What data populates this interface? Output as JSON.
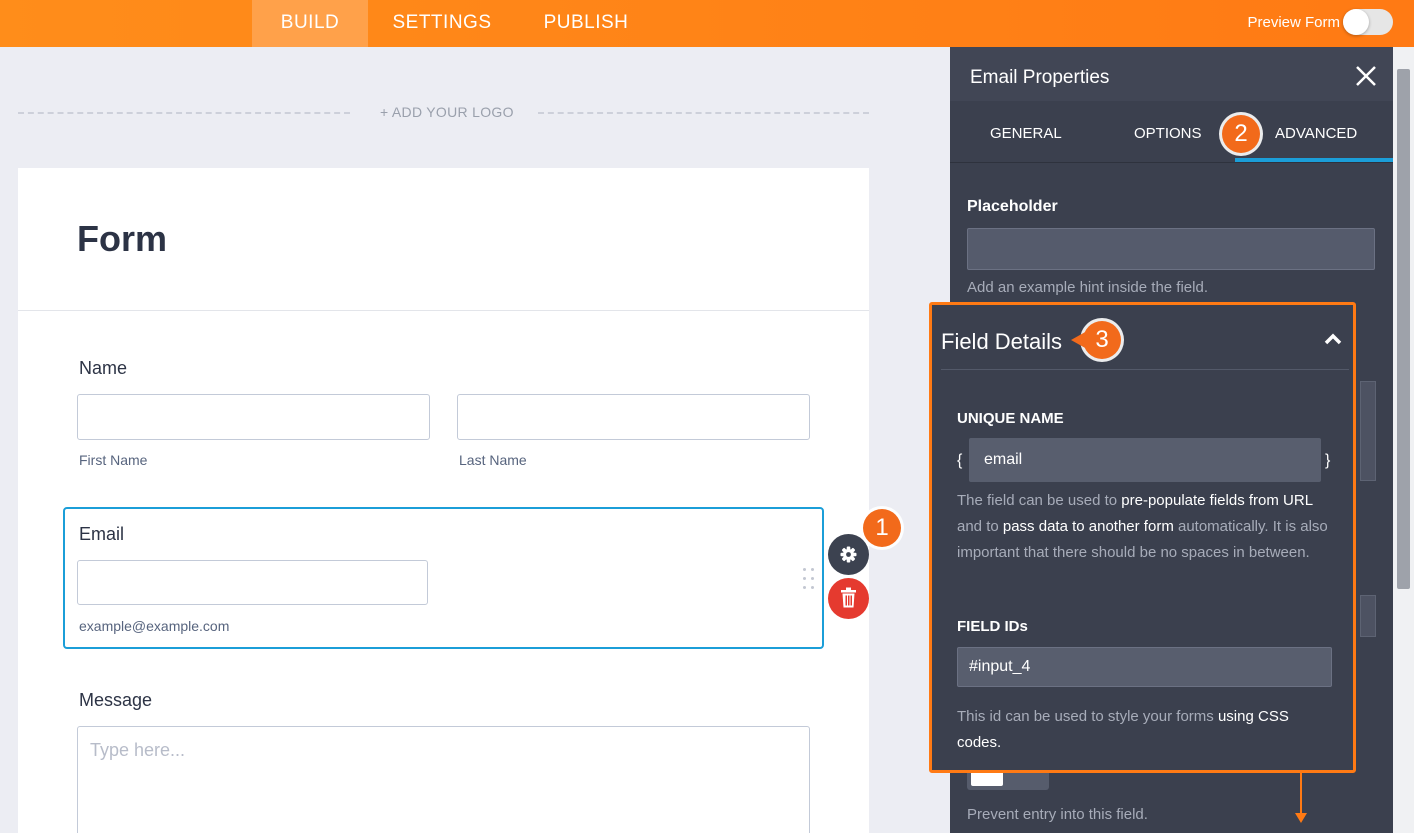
{
  "topbar": {
    "tabs": [
      "BUILD",
      "SETTINGS",
      "PUBLISH"
    ],
    "preview_label": "Preview Form"
  },
  "canvas": {
    "add_logo": "+ ADD YOUR LOGO",
    "form_title": "Form",
    "name_label": "Name",
    "first_name": "First Name",
    "last_name": "Last Name",
    "email_label": "Email",
    "email_sublabel": "example@example.com",
    "message_label": "Message",
    "message_placeholder": "Type here..."
  },
  "panel": {
    "title": "Email Properties",
    "tabs": [
      "GENERAL",
      "OPTIONS",
      "ADVANCED"
    ],
    "placeholder_label": "Placeholder",
    "placeholder_hint": "Add an example hint inside the field.",
    "bottom_hint": "Prevent entry into this field."
  },
  "details": {
    "title": "Field Details",
    "unique_name_label": "UNIQUE NAME",
    "unique_name_value": "email",
    "desc1_a": "The field can be used to ",
    "desc1_b": "pre-populate fields from URL",
    "desc1_c": " and to ",
    "desc1_d": "pass data to another form",
    "desc1_e": " automatically. It is also important that there should be no spaces in between.",
    "field_ids_label": "FIELD IDs",
    "field_ids_value": "#input_4",
    "desc2_a": "This id can be used to style your forms ",
    "desc2_b": "using CSS codes."
  },
  "badges": [
    "1",
    "2",
    "3"
  ],
  "colors": {
    "accent": "#ff7a14",
    "focus": "#1b9ed8",
    "delete": "#e53a2f",
    "panel": "#3b404e"
  }
}
